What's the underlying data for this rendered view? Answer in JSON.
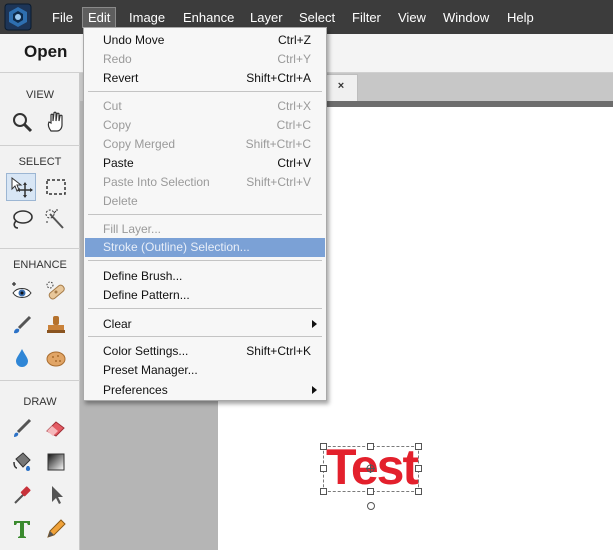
{
  "menubar": {
    "logo": "photoshop-elements-logo",
    "items": [
      "File",
      "Edit",
      "Image",
      "Enhance",
      "Layer",
      "Select",
      "Filter",
      "View",
      "Window",
      "Help"
    ],
    "active": "Edit"
  },
  "header": {
    "open_label": "Open"
  },
  "toolbox": {
    "sections": [
      "VIEW",
      "SELECT",
      "ENHANCE",
      "DRAW"
    ],
    "tools": [
      "zoom-tool-icon",
      "hand-tool-icon",
      "move-tool-icon",
      "rectangular-marquee-icon",
      "lasso-tool-icon",
      "quick-selection-icon",
      "red-eye-icon",
      "spot-healing-icon",
      "smart-brush-icon",
      "clone-stamp-icon",
      "blur-tool-icon",
      "sponge-tool-icon",
      "brush-tool-icon",
      "eraser-tool-icon",
      "paint-bucket-icon",
      "gradient-tool-icon",
      "eyedropper-icon",
      "custom-shape-icon",
      "type-tool-icon",
      "pencil-tool-icon"
    ]
  },
  "document": {
    "tab_close": "×",
    "text_layer": "Test",
    "text_color": "#e3202c"
  },
  "edit_menu": {
    "items": [
      {
        "label": "Undo Move",
        "shortcut": "Ctrl+Z",
        "enabled": true
      },
      {
        "label": "Redo",
        "shortcut": "Ctrl+Y",
        "enabled": false
      },
      {
        "label": "Revert",
        "shortcut": "Shift+Ctrl+A",
        "enabled": true
      },
      {
        "label": "Cut",
        "shortcut": "Ctrl+X",
        "enabled": false
      },
      {
        "label": "Copy",
        "shortcut": "Ctrl+C",
        "enabled": false
      },
      {
        "label": "Copy Merged",
        "shortcut": "Shift+Ctrl+C",
        "enabled": false
      },
      {
        "label": "Paste",
        "shortcut": "Ctrl+V",
        "enabled": true
      },
      {
        "label": "Paste Into Selection",
        "shortcut": "Shift+Ctrl+V",
        "enabled": false
      },
      {
        "label": "Delete",
        "shortcut": "",
        "enabled": false
      },
      {
        "label": "Fill Layer...",
        "shortcut": "",
        "enabled": false
      },
      {
        "label": "Stroke (Outline) Selection...",
        "shortcut": "",
        "enabled": false,
        "highlighted": true
      },
      {
        "label": "Define Brush...",
        "shortcut": "",
        "enabled": true
      },
      {
        "label": "Define Pattern...",
        "shortcut": "",
        "enabled": true
      },
      {
        "label": "Clear",
        "shortcut": "",
        "enabled": true,
        "submenu": true
      },
      {
        "label": "Color Settings...",
        "shortcut": "Shift+Ctrl+K",
        "enabled": true
      },
      {
        "label": "Preset Manager...",
        "shortcut": "",
        "enabled": true
      },
      {
        "label": "Preferences",
        "shortcut": "",
        "enabled": true,
        "submenu": true
      }
    ]
  },
  "colors": {
    "menubar_bg": "#3c3c3c",
    "highlight": "#7ba1d6",
    "accent_red": "#e3202c"
  }
}
